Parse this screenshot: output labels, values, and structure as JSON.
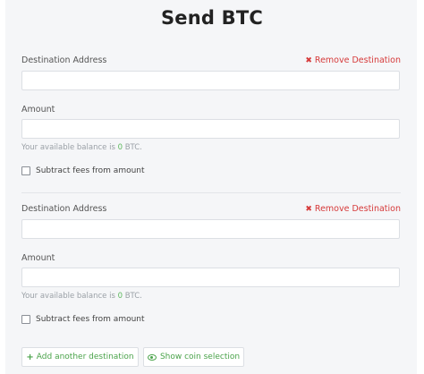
{
  "title": "Send BTC",
  "destinations": [
    {
      "address_label": "Destination Address",
      "remove_label": "Remove Destination",
      "address_value": "",
      "amount_label": "Amount",
      "amount_value": "",
      "balance_prefix": "Your available balance is",
      "balance_value": "0",
      "balance_suffix": "BTC.",
      "subtract_fees_label": "Subtract fees from amount",
      "subtract_fees_checked": false
    },
    {
      "address_label": "Destination Address",
      "remove_label": "Remove Destination",
      "address_value": "",
      "amount_label": "Amount",
      "amount_value": "",
      "balance_prefix": "Your available balance is",
      "balance_value": "0",
      "balance_suffix": "BTC.",
      "subtract_fees_label": "Subtract fees from amount",
      "subtract_fees_checked": false
    }
  ],
  "actions": {
    "add_destination_label": "Add another destination",
    "show_coin_selection_label": "Show coin selection"
  },
  "colors": {
    "remove": "#d63a3a",
    "accent_green": "#4aa34a",
    "balance_number": "#5cb85c"
  },
  "icons": {
    "remove": "close-icon",
    "add": "plus-icon",
    "show": "eye-icon"
  }
}
